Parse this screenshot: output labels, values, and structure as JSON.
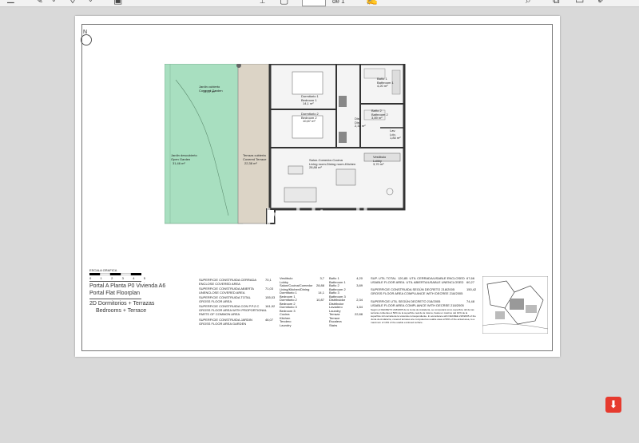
{
  "viewer": {
    "toolbar_icons": [
      "list-icon",
      "pen-icon",
      "chevron-down-icon",
      "marker-icon",
      "chevron-down-icon",
      "sidebar-icon",
      "cursor-icon",
      "image-icon",
      "sign-icon",
      "search-icon",
      "copy-icon",
      "page-icon",
      "edit-icon"
    ],
    "page_indicator": "de 1",
    "colors": {
      "viewer_bg": "#d9d9d9",
      "garden": "#a8dfc0",
      "terrace": "#dcd4c6",
      "pdf_badge": "#e63a2e"
    }
  },
  "plan": {
    "north": "N",
    "watermark": "habitaclia",
    "rooms": [
      {
        "name": "Jardin cubierto\nCovered Garden",
        "area": "14,07 m²"
      },
      {
        "name": "Jardin descubierto\nOpen Garden",
        "area": "31,46 m²"
      },
      {
        "name": "Terraza cubierta\nCovered Terrace",
        "area": "22,38 m²"
      },
      {
        "name": "Dormitorio 1\nBedroom 1",
        "area": "14,1 m²"
      },
      {
        "name": "Dormitorio 2\nBedroom 2",
        "area": "10,87 m²"
      },
      {
        "name": "Baño 1\nBathroom 1",
        "area": "4,20 m²"
      },
      {
        "name": "Baño 2\nBathroom 2",
        "area": "3,89 m²"
      },
      {
        "name": "Dist.\nDist.",
        "area": "2,34 m²"
      },
      {
        "name": "Lav.\nLdo.",
        "area": "1,84 m²"
      },
      {
        "name": "Salon-Comedor-Cocina\nLiving room-Dining room-Kitchen",
        "area": "28,88 m²"
      },
      {
        "name": "Vestibulo\nLobby",
        "area": "3,70 m²"
      }
    ]
  },
  "legend": {
    "scale_label": "ESCALA GRAFICA",
    "scale_ticks": [
      "0",
      "1",
      "2",
      "3",
      "4",
      "5"
    ],
    "lines": [
      "Portal A  Planta P0  Vivienda A6",
      "Portal   Flat   Floorplan",
      "2D  Dormitorios + Terrazas",
      "Bedrooms + Terrace"
    ]
  },
  "areas_left": [
    {
      "label": "SUPERFICIE CONSTRUIDA CERRADA\nENCLOSE COVERED AREA",
      "value": "70,1"
    },
    {
      "label": "SUPERFICIE CONSTRUIDA ABIERTA\nUNENCLOSE COVERED AREA",
      "value": "71,03"
    },
    {
      "label": "SUPERFICIE CONSTRUIDA TOTAL\nGROSS FLOOR AREA",
      "value": "155,03"
    },
    {
      "label": "SUPERFICIE CONSTRUIDA CON P.P.Z.C\nGROSS FLOOR AREA WITH PROPORTIONAL\nPARTS OF COMMON AREA",
      "value": "161,92"
    },
    {
      "label": "SUPERFICIE CONSTRUIDA JARDIN\nGROSS FLOOR AREA GARDEN",
      "value": "46,07"
    }
  ],
  "areas_rooms_a": [
    {
      "label": "Vestíbulo\nLobby",
      "value": "3,7"
    },
    {
      "label": "Salon/Cocina/Comedor\nLiving/Kitchen/Dining",
      "value": "28,88"
    },
    {
      "label": "Dormitorio 1\nBedroom 1",
      "value": "14,1"
    },
    {
      "label": "Dormitorio 2\nBedroom 2",
      "value": "10,87"
    },
    {
      "label": "Dormitorio 3\nBedroom 3",
      "value": ""
    },
    {
      "label": "Cocina\nKitchen",
      "value": ""
    },
    {
      "label": "Tendero\nLaundry",
      "value": ""
    }
  ],
  "areas_rooms_b": [
    {
      "label": "Baño 1\nBathroom 1",
      "value": "4,20"
    },
    {
      "label": "Baño 2\nBathroom 2",
      "value": "3,89"
    },
    {
      "label": "Baño 3\nBathroom 3",
      "value": ""
    },
    {
      "label": "Distribuidor\nDistributor",
      "value": "2,34"
    },
    {
      "label": "Lavadero\nLaundry",
      "value": "1,84"
    },
    {
      "label": "Terraza\nTerrace",
      "value": "22,88"
    },
    {
      "label": "Escalera\nStairs",
      "value": ""
    }
  ],
  "areas_right": [
    {
      "label": "SUP. UTIL TOTAL  120,85  UTIL CERRADA/USABLE ENCLOSED\nUSABLE FLOOR AREA  UTIL ABIERTA/USABLE UNENCLOSED",
      "value": "67,66\n60,27"
    },
    {
      "label": "SUPERFICIE CONSTRUIDA SEGÚN DECRETO 218/2005\nGROSS FLOOR AREA COMPLIANCE WITH DECREE 218/2005",
      "value": "150,42"
    },
    {
      "label": "SUPERFICIE UTIL SEGÚN DECRETO 218/2005\nUSABLE FLOOR AREA COMPLIANCE WITH DECREE 218/2005",
      "value": "74,48"
    }
  ],
  "note": "Según el DECRETO 218/2005 de la Junta de Andalucía, se computará como superficie útil de las terrazas cubiertas el 50% de la superficie real de la misma, hasta un máximo del 10% de la superficie útil cerrada de la vivienda correspondiente.\nIn accordance with DECREE 218/2005 of the Junta de Andalucía, covered terraces are computed as usable area at 50% of the actual area, to a maximum of 10% of the usable enclosed surface.",
  "pdf_badge": "⬇"
}
